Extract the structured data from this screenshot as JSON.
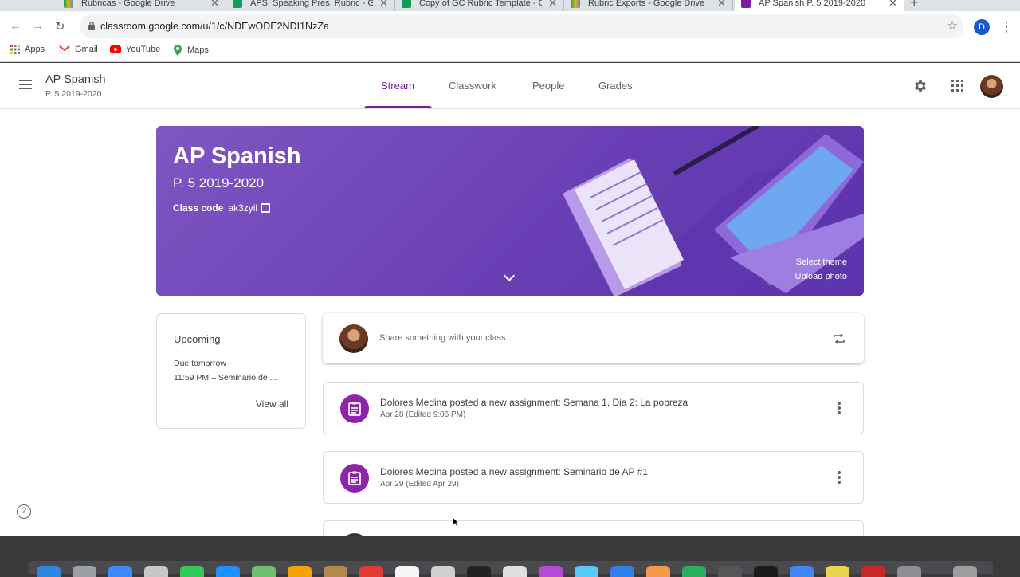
{
  "browser": {
    "tabs": [
      {
        "title": "Rubricas - Google Drive",
        "icon": "drive-icon"
      },
      {
        "title": "APS: Speaking Pres. Rubric - G",
        "icon": "sheets-icon"
      },
      {
        "title": "Copy of GC Rubric Template - G",
        "icon": "sheets-icon"
      },
      {
        "title": "Rubric Exports - Google Drive",
        "icon": "drive-icon"
      },
      {
        "title": "AP Spanish P. 5 2019-2020",
        "icon": "classroom-icon"
      }
    ],
    "url": "classroom.google.com/u/1/c/NDEwODE2NDI1NzZa",
    "profile_initial": "D",
    "bookmarks": [
      "Apps",
      "Gmail",
      "YouTube",
      "Maps"
    ]
  },
  "classroom": {
    "class_name": "AP Spanish",
    "section": "P. 5 2019-2020",
    "tabs": [
      "Stream",
      "Classwork",
      "People",
      "Grades"
    ],
    "active_tab": "Stream",
    "banner": {
      "title": "AP Spanish",
      "section": "P. 5 2019-2020",
      "class_code_label": "Class code",
      "class_code": "ak3zyil",
      "select_theme": "Select theme",
      "upload_photo": "Upload photo"
    },
    "upcoming": {
      "title": "Upcoming",
      "due_label": "Due tomorrow",
      "item": "11:59 PM – Seminario de ...",
      "view_all": "View all"
    },
    "share_placeholder": "Share something with your class...",
    "posts": [
      {
        "title": "Dolores Medina posted a new assignment: Semana 1, Dia 2: La pobreza",
        "date": "Apr 28 (Edited 9:06 PM)"
      },
      {
        "title": "Dolores Medina posted a new assignment: Seminario de AP #1",
        "date": "Apr 29 (Edited Apr 29)"
      }
    ]
  },
  "colors": {
    "accent": "#7b1fa2",
    "banner": "#6a3fb5",
    "assignment_icon": "#8e24aa"
  }
}
